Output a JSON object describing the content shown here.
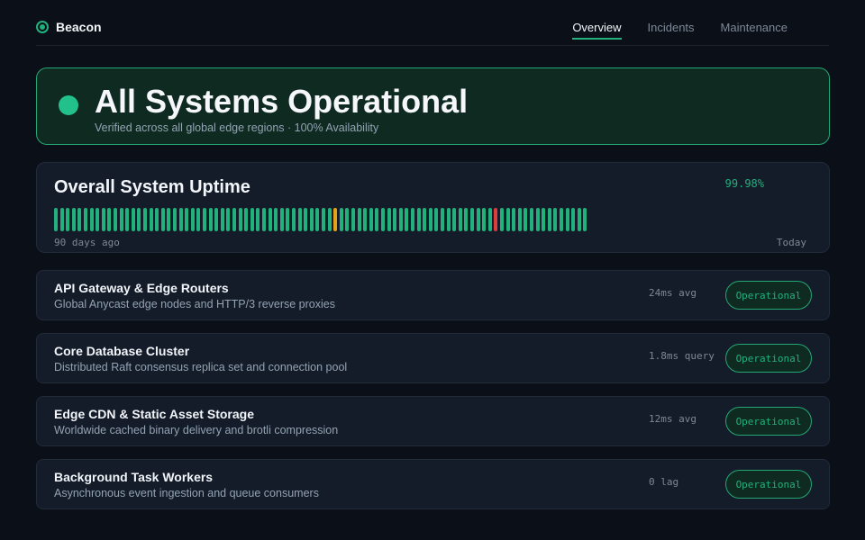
{
  "header": {
    "brand": "Beacon",
    "tabs": [
      {
        "label": "Overview",
        "active": true
      },
      {
        "label": "Incidents",
        "active": false
      },
      {
        "label": "Maintenance",
        "active": false
      }
    ]
  },
  "status": {
    "title": "All Systems Operational",
    "subtitle": "Verified across all global edge regions · 100% Availability"
  },
  "uptime": {
    "title": "Overall System Uptime",
    "percent": "99.98%",
    "start_label": "90 days ago",
    "end_label": "Today",
    "days": 90,
    "degraded_days": [
      47
    ],
    "outage_days": [
      74
    ]
  },
  "services": [
    {
      "name": "API Gateway & Edge Routers",
      "description": "Global Anycast edge nodes and HTTP/3 reverse proxies",
      "metric": "24ms avg",
      "status": "Operational"
    },
    {
      "name": "Core Database Cluster",
      "description": "Distributed Raft consensus replica set and connection pool",
      "metric": "1.8ms query",
      "status": "Operational"
    },
    {
      "name": "Edge CDN & Static Asset Storage",
      "description": "Worldwide cached binary delivery and brotli compression",
      "metric": "12ms avg",
      "status": "Operational"
    },
    {
      "name": "Background Task Workers",
      "description": "Asynchronous event ingestion and queue consumers",
      "metric": "0 lag",
      "status": "Operational"
    }
  ],
  "colors": {
    "accent": "#22b07d",
    "degraded": "#e5a11c",
    "outage": "#dc3d3d",
    "background": "#0b0f17"
  }
}
